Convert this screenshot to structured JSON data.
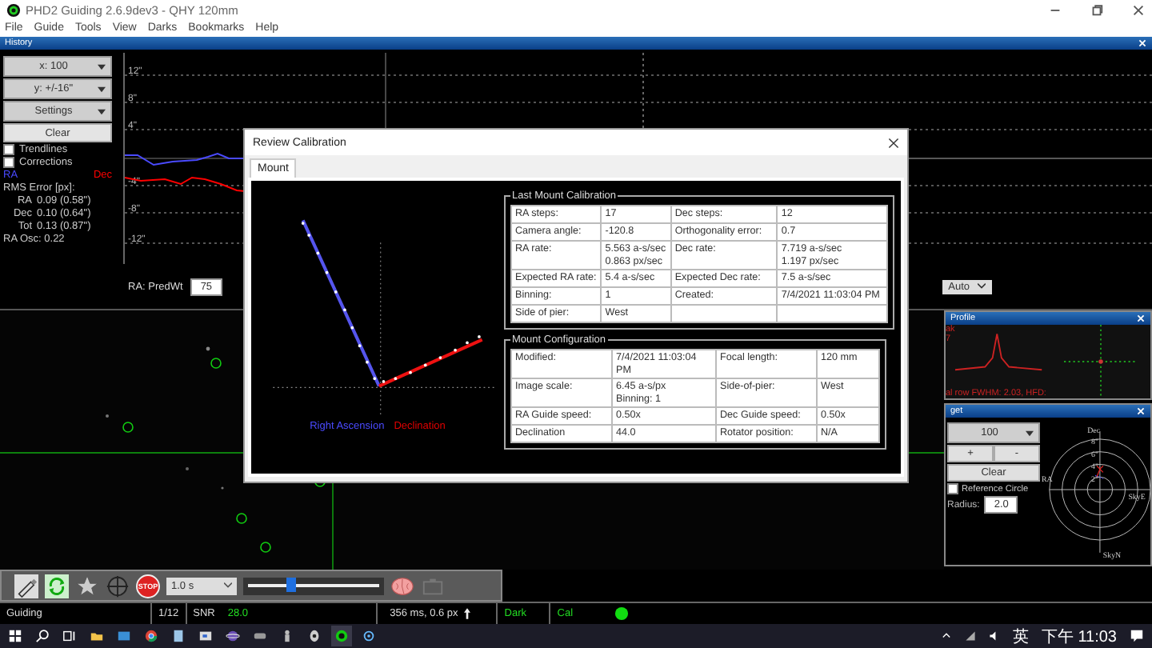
{
  "window": {
    "title": "PHD2 Guiding 2.6.9dev3 - QHY 120mm"
  },
  "menu": [
    "File",
    "Guide",
    "Tools",
    "View",
    "Darks",
    "Bookmarks",
    "Help"
  ],
  "history": {
    "title": "History",
    "controls": [
      "x: 100",
      "y: +/-16\"",
      "Settings"
    ],
    "clear": "Clear",
    "options": [
      {
        "label": "Trendlines",
        "checked": false
      },
      {
        "label": "Corrections",
        "checked": false
      }
    ],
    "legend": [
      {
        "label": "RA",
        "color": "#4a4aff"
      },
      {
        "label": "Dec",
        "color": "#ff0000"
      }
    ],
    "rms_title": "RMS Error [px]:",
    "rms": [
      {
        "axis": "RA",
        "value": "0.09 (0.58\")"
      },
      {
        "axis": "Dec",
        "value": "0.10 (0.64\")"
      },
      {
        "axis": "Tot",
        "value": "0.13 (0.87\")"
      }
    ],
    "osc": "RA Osc: 0.22",
    "y_labels": [
      "12\"",
      "8\"",
      "4\"",
      "-4\"",
      "-8\"",
      "-12\""
    ],
    "pred_label": "RA: PredWt",
    "pred_value": "75",
    "scale_mode": "Auto"
  },
  "dialog": {
    "title": "Review Calibration",
    "tabs": [
      {
        "label": "Mount",
        "selected": true
      }
    ],
    "legend": [
      {
        "label": "Right Ascension",
        "color": "#4a4aff"
      },
      {
        "label": "Declination",
        "color": "#e00000"
      }
    ],
    "sections": [
      {
        "title": "Last Mount Calibration",
        "rows": [
          [
            "RA steps:",
            "17",
            "Dec steps:",
            "12"
          ],
          [
            "Camera angle:",
            "-120.8",
            "Orthogonality error:",
            "0.7"
          ],
          [
            "RA rate:",
            "5.563 a-s/sec\n0.863 px/sec",
            "Dec rate:",
            "7.719 a-s/sec\n1.197 px/sec"
          ],
          [
            "Expected RA rate:",
            "5.4 a-s/sec",
            "Expected Dec rate:",
            "7.5 a-s/sec"
          ],
          [
            "Binning:",
            "1",
            "Created:",
            "7/4/2021 11:03:04 PM"
          ],
          [
            "Side of pier:",
            "West"
          ]
        ]
      },
      {
        "title": "Mount Configuration",
        "rows": [
          [
            "Modified:",
            "7/4/2021 11:03:04 PM",
            "Focal length:",
            "120 mm"
          ],
          [
            "Image scale:",
            "6.45 a-s/px\nBinning: 1",
            "Side-of-pier:",
            "West"
          ],
          [
            "RA Guide speed:",
            "0.50x",
            "Dec Guide speed:",
            "0.50x"
          ],
          [
            "Declination",
            "44.0",
            "Rotator position:",
            "N/A"
          ]
        ]
      }
    ]
  },
  "profile": {
    "title": "Profile",
    "fragments": [
      "ak",
      "7"
    ],
    "caption": "al row FWHM: 2.03, HFD:"
  },
  "target": {
    "title": "get",
    "scale": "100",
    "plus": "+",
    "minus": "-",
    "clear": "Clear",
    "ref_circle": {
      "label": "Reference Circle",
      "checked": false
    },
    "radius_label": "Radius:",
    "radius": "2.0",
    "axes": [
      "Dec",
      "RA",
      "SkyE",
      "SkyN"
    ],
    "rings": [
      "8\"",
      "6\"",
      "4\"",
      "2\""
    ]
  },
  "toolbar": {
    "exposure": "1.0 s",
    "stop": "STOP",
    "level": 0.33
  },
  "status": {
    "state": "Guiding",
    "frame": "1/12",
    "snr_label": "SNR",
    "snr": "28.0",
    "timing": "356 ms, 0.6 px",
    "dark": "Dark",
    "cal": "Cal"
  },
  "taskbar": {
    "ime": "英",
    "clock": "下午 11:03"
  }
}
